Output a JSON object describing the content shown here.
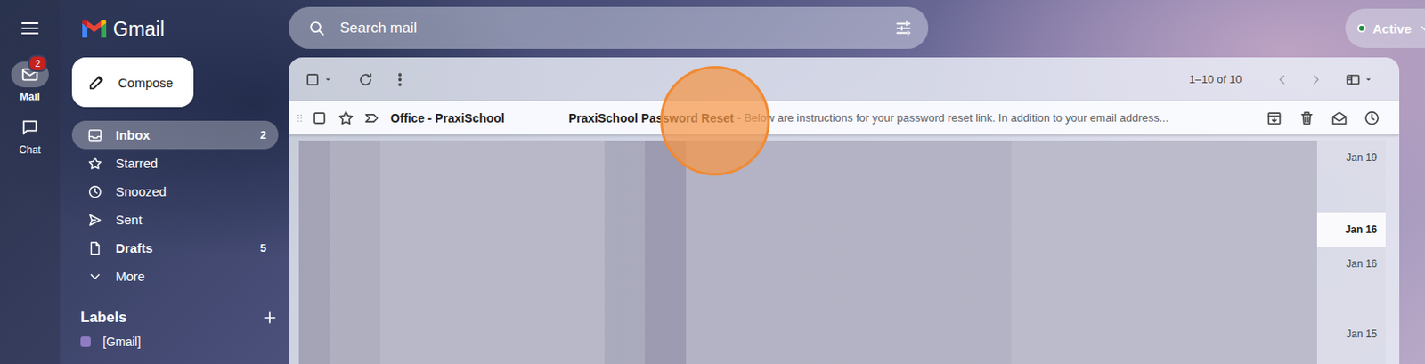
{
  "rail": [
    {
      "label": "Mail",
      "selected": true,
      "badge": "2"
    },
    {
      "label": "Chat",
      "selected": false
    }
  ],
  "logo": "Gmail",
  "compose": "Compose",
  "nav": [
    {
      "label": "Inbox",
      "count": "2",
      "selected": true,
      "bold": true
    },
    {
      "label": "Starred",
      "selected": false,
      "bold": false
    },
    {
      "label": "Snoozed",
      "selected": false,
      "bold": false
    },
    {
      "label": "Sent",
      "selected": false,
      "bold": false
    },
    {
      "label": "Drafts",
      "count": "5",
      "selected": false,
      "bold": true
    },
    {
      "label": "More",
      "selected": false,
      "bold": false
    }
  ],
  "labels": {
    "title": "Labels",
    "items": [
      "[Gmail]"
    ]
  },
  "search": {
    "placeholder": "Search mail"
  },
  "status": {
    "label": "Active",
    "color": "#1e8e3e"
  },
  "toolbar": {
    "range": "1–10 of 10"
  },
  "emails": [
    {
      "sender": "Office - PraxiSchool",
      "subject": "PraxiSchool Password Reset",
      "snippet": "- Below are instructions for your password reset link. In addition to your email address...",
      "hovered": true
    }
  ],
  "redacted_rows": [
    {
      "date": "Jan 19",
      "unread": false
    },
    {
      "date": "Jan 16",
      "unread": true
    },
    {
      "date": "Jan 16",
      "unread": false
    },
    {
      "date": "Jan 15",
      "unread": false
    }
  ]
}
